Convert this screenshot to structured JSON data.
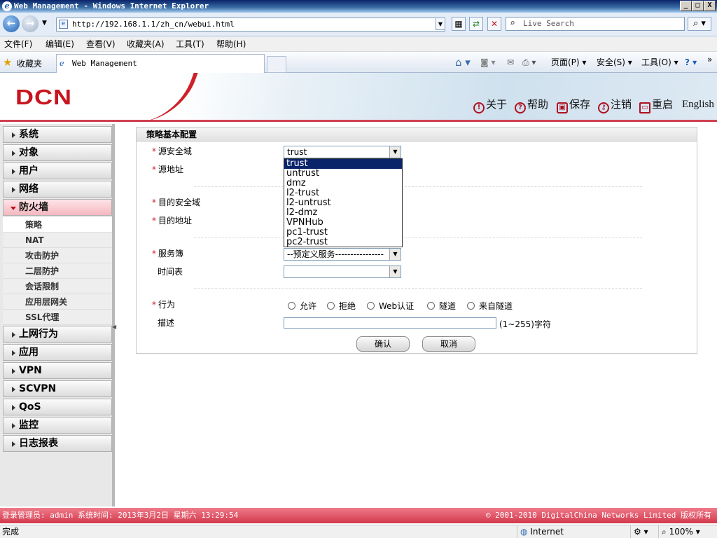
{
  "window": {
    "title": "Web Management - Windows Internet Explorer",
    "minimize": "_",
    "maximize": "□",
    "close": "X"
  },
  "browser": {
    "url": "http://192.168.1.1/zh_cn/webui.html",
    "search_placeholder": "Live Search",
    "menu": [
      "文件(F)",
      "编辑(E)",
      "查看(V)",
      "收藏夹(A)",
      "工具(T)",
      "帮助(H)"
    ],
    "favorites_label": "收藏夹",
    "tab_title": "Web Management",
    "command_bar": [
      "页面(P)",
      "安全(S)",
      "工具(O)"
    ],
    "status_text": "完成",
    "zone": "Internet",
    "zoom": "100%"
  },
  "header": {
    "logo": "DCN",
    "links": [
      "关于",
      "帮助",
      "保存",
      "注销",
      "重启"
    ],
    "language": "English"
  },
  "sidebar": {
    "top_items": [
      "系统",
      "对象",
      "用户",
      "网络"
    ],
    "active_item": "防火墙",
    "sub_items": [
      "策略",
      "NAT",
      "攻击防护",
      "二层防护",
      "会话限制",
      "应用层网关",
      "SSL代理"
    ],
    "selected_sub": 0,
    "bottom_items": [
      "上网行为",
      "应用",
      "VPN",
      "SCVPN",
      "QoS",
      "监控",
      "日志报表"
    ]
  },
  "form": {
    "title": "策略基本配置",
    "required_mark": "*",
    "labels": {
      "src_zone": "源安全域",
      "src_addr": "源地址",
      "dst_zone": "目的安全域",
      "dst_addr": "目的地址",
      "service": "服务簿",
      "schedule": "时间表",
      "action": "行为",
      "description": "描述"
    },
    "src_zone_value": "trust",
    "service_value": "--预定义服务----------------",
    "schedule_value": "",
    "actions": [
      "允许",
      "拒绝",
      "Web认证",
      "隧道",
      "来自隧道"
    ],
    "desc_hint": "(1~255)字符",
    "confirm": "确认",
    "cancel": "取消"
  },
  "dropdown": {
    "options": [
      "trust",
      "untrust",
      "dmz",
      "l2-trust",
      "l2-untrust",
      "l2-dmz",
      "VPNHub",
      "pc1-trust",
      "pc2-trust"
    ],
    "highlighted": 0
  },
  "footer": {
    "login_info": "登录管理员: admin 系统时间: 2013年3月2日 星期六 13:29:54",
    "copyright": "© 2001-2010 DigitalChina Networks Limited 版权所有"
  },
  "colors": {
    "accent": "#d0202a",
    "footer": "#d2384c",
    "selection": "#0a246a"
  }
}
